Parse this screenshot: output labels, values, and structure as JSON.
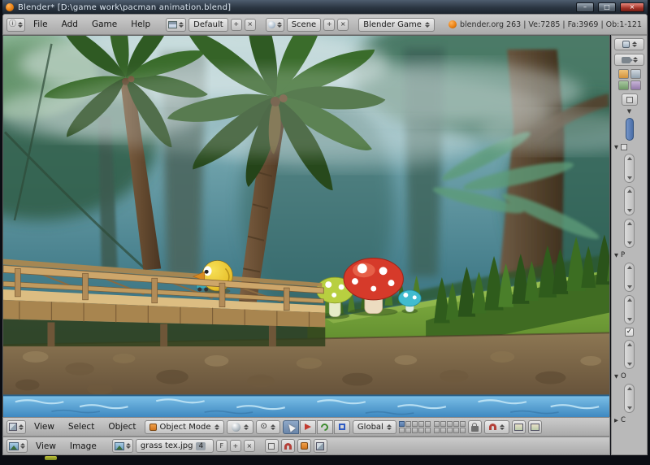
{
  "window": {
    "title": "Blender* [D:\\game work\\pacman animation.blend]"
  },
  "icons": {
    "minimize": "–",
    "maximize": "□",
    "close": "×",
    "chevron_down": "▼",
    "chevron_right": "▶",
    "check": "✓",
    "x": "×",
    "plus": "+",
    "info": "ⓘ",
    "pivot": "⊙"
  },
  "info_header": {
    "menus": [
      "File",
      "Add",
      "Game",
      "Help"
    ],
    "layout": "Default",
    "scene": "Scene",
    "engine": "Blender Game",
    "stats": "blender.org 263 | Ve:7285 | Fa:3969 | Ob:1-121"
  },
  "view3d_header": {
    "menus": [
      "View",
      "Select",
      "Object"
    ],
    "mode": "Object Mode",
    "orientation": "Global"
  },
  "image_header": {
    "menus": [
      "View",
      "Image"
    ],
    "image_name": "grass tex.jpg",
    "users_count": "4",
    "fake_user": "F"
  },
  "right_panel": {
    "panel_p": "P",
    "panel_o": "O",
    "panel_c": "C"
  }
}
